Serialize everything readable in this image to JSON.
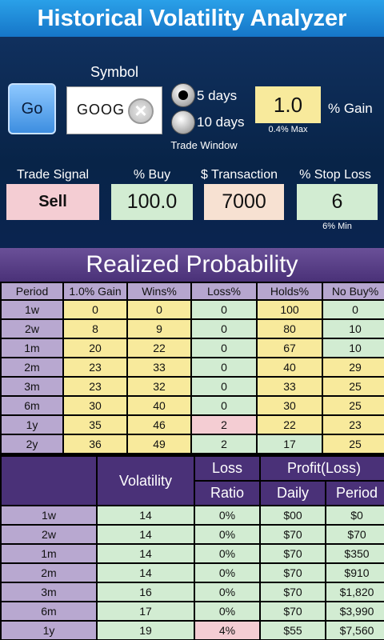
{
  "app": {
    "title": "Historical Volatility Analyzer"
  },
  "controls": {
    "go_label": "Go",
    "symbol_label": "Symbol",
    "symbol_value": "GOOG",
    "clear_icon": "clear-icon",
    "trade_window": {
      "label": "Trade Window",
      "options": [
        "5 days",
        "10 days"
      ],
      "selected": "5 days"
    },
    "gain": {
      "value": "1.0",
      "unit_label": "% Gain",
      "hint": "0.4% Max"
    },
    "trade_signal": {
      "label": "Trade Signal",
      "value": "Sell"
    },
    "pct_buy": {
      "label": "% Buy",
      "value": "100.0"
    },
    "transaction": {
      "label": "$ Transaction",
      "value": "7000"
    },
    "stop_loss": {
      "label": "% Stop Loss",
      "value": "6",
      "hint": "6% Min"
    }
  },
  "probability": {
    "title": "Realized Probability",
    "headers": [
      "Period",
      "1.0% Gain",
      "Wins%",
      "Loss%",
      "Holds%",
      "No Buy%"
    ],
    "rows": [
      [
        "1w",
        "0",
        "0",
        "0",
        "100",
        "0"
      ],
      [
        "2w",
        "8",
        "9",
        "0",
        "80",
        "10"
      ],
      [
        "1m",
        "20",
        "22",
        "0",
        "67",
        "10"
      ],
      [
        "2m",
        "23",
        "33",
        "0",
        "40",
        "29"
      ],
      [
        "3m",
        "23",
        "32",
        "0",
        "33",
        "25"
      ],
      [
        "6m",
        "30",
        "40",
        "0",
        "30",
        "25"
      ],
      [
        "1y",
        "35",
        "46",
        "2",
        "22",
        "23"
      ],
      [
        "2y",
        "36",
        "49",
        "2",
        "17",
        "25"
      ]
    ]
  },
  "volatility": {
    "headers": {
      "volatility": "Volatility",
      "loss_ratio_1": "Loss",
      "loss_ratio_2": "Ratio",
      "profit": "Profit(Loss)",
      "daily": "Daily",
      "period": "Period"
    },
    "rows": [
      [
        "1w",
        "14",
        "0%",
        "$00",
        "$0"
      ],
      [
        "2w",
        "14",
        "0%",
        "$70",
        "$70"
      ],
      [
        "1m",
        "14",
        "0%",
        "$70",
        "$350"
      ],
      [
        "2m",
        "14",
        "0%",
        "$70",
        "$910"
      ],
      [
        "3m",
        "16",
        "0%",
        "$70",
        "$1,820"
      ],
      [
        "6m",
        "17",
        "0%",
        "$70",
        "$3,990"
      ],
      [
        "1y",
        "19",
        "4%",
        "$55",
        "$7,560"
      ]
    ]
  }
}
